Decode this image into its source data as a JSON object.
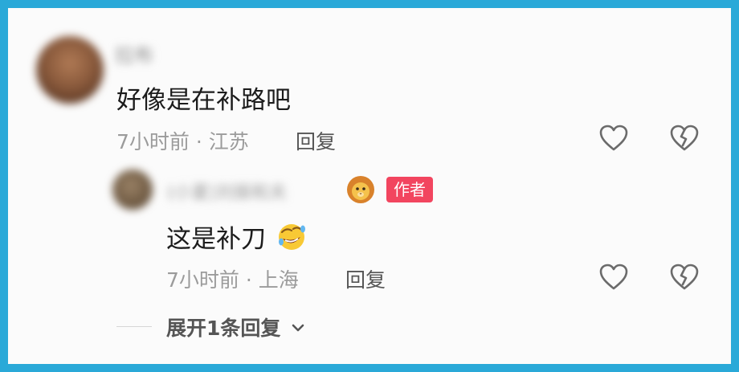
{
  "comment": {
    "username": "拉布",
    "text": "好像是在补路吧",
    "meta": "7小时前 · 江苏",
    "reply_label": "回复"
  },
  "reply": {
    "username": "(小夏)刘振和夫",
    "badge": "作者",
    "text": "这是补刀",
    "meta": "7小时前 · 上海",
    "reply_label": "回复"
  },
  "expand": {
    "label": "展开1条回复"
  },
  "icons": {
    "like": "heart-outline-icon",
    "dislike": "broken-heart-icon",
    "emoji_text": "rofl-emoji-icon",
    "user_badge": "lion-emoji-icon",
    "expand": "chevron-down-icon"
  },
  "colors": {
    "background": "#fbfbfb",
    "frame": "#2aa9d8",
    "badge": "#f2455f",
    "meta_text": "#9b9b9b"
  }
}
